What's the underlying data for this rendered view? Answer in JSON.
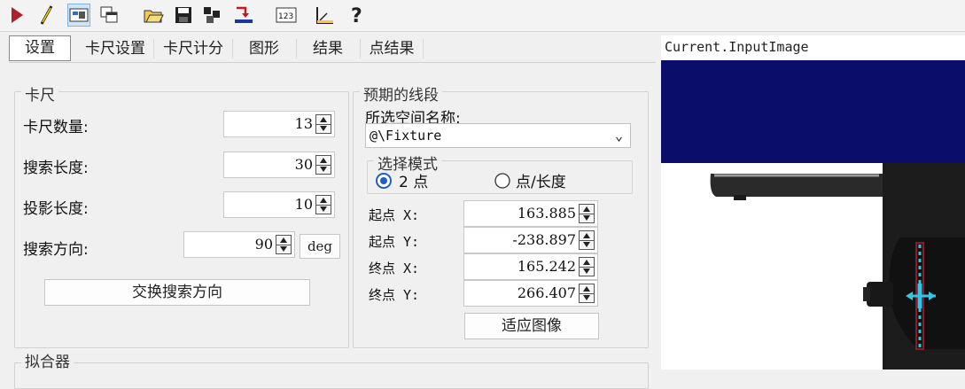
{
  "tabs": [
    "设置",
    "卡尺设置",
    "卡尺计分",
    "图形",
    "结果",
    "点结果"
  ],
  "caliper": {
    "group_title": "卡尺",
    "count_label": "卡尺数量:",
    "count": "13",
    "search_len_label": "搜索长度:",
    "search_len": "30",
    "proj_len_label": "投影长度:",
    "proj_len": "10",
    "dir_label": "搜索方向:",
    "dir": "90",
    "dir_unit": "deg",
    "swap_button": "交换搜索方向"
  },
  "segment": {
    "group_title": "预期的线段",
    "space_label": "所选空间名称:",
    "space_value": "@\\Fixture",
    "mode_title": "选择模式",
    "mode_2pt": "2 点",
    "mode_ptlen": "点/长度",
    "start_x_label": "起点 X:",
    "start_x": "163.885",
    "start_y_label": "起点 Y:",
    "start_y": "-238.897",
    "end_x_label": "终点 X:",
    "end_x": "165.242",
    "end_y_label": "终点 Y:",
    "end_y": "266.407",
    "fit_button": "适应图像"
  },
  "fitter": {
    "group_title": "拟合器"
  },
  "viewer": {
    "title": "Current.InputImage"
  },
  "colors": {
    "run": "#b0202a",
    "navy": "#0b0d6b",
    "caliper": "#2fc6e8",
    "caliper_edge": "#8b1a2a"
  }
}
